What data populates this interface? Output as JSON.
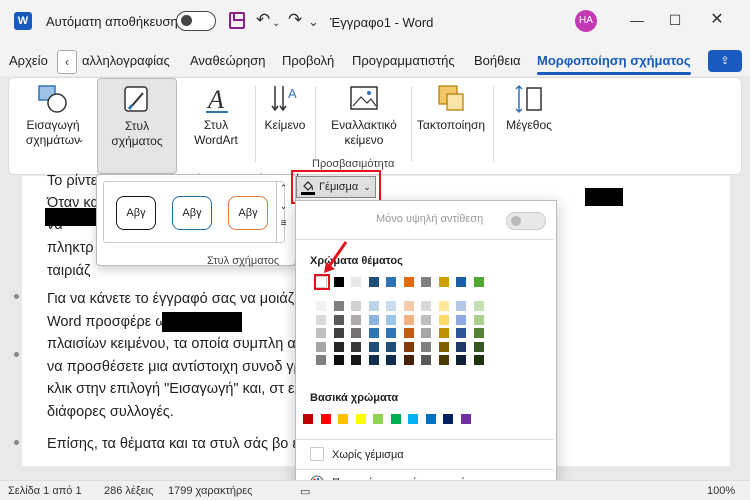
{
  "titlebar": {
    "app_logo": "W",
    "autosave_label": "Αυτόματη αποθήκευση",
    "document_title": "Έγγραφο1  -  Word",
    "avatar_initials": "HA",
    "icons": [
      "word-icon",
      "save-icon",
      "undo-icon",
      "redo-icon",
      "customize-icon"
    ]
  },
  "tabs": {
    "items": [
      "Αρχείο",
      "αλληλογραφίας",
      "Αναθεώρηση",
      "Προβολή",
      "Προγραμματιστής",
      "Βοήθεια"
    ],
    "active": "Μορφοποίηση σχήματος",
    "scroll_left": "‹"
  },
  "ribbon": {
    "groups": [
      {
        "label": "Εισαγωγή σχημάτων",
        "icon": "insert-shapes-icon"
      },
      {
        "label": "Στυλ σχήματος",
        "icon": "shape-styles-icon",
        "selected": true
      },
      {
        "label": "Στυλ WordArt",
        "icon": "wordart-icon"
      },
      {
        "label": "Κείμενο",
        "icon": "text-direction-icon"
      },
      {
        "label": "Εναλλακτικό κείμενο",
        "icon": "alt-text-icon"
      },
      {
        "label": "Τακτοποίηση",
        "icon": "arrange-icon"
      },
      {
        "label": "Μέγεθος",
        "icon": "size-icon"
      }
    ],
    "accessibility_caption": "Προσβασιμότητα"
  },
  "gallery": {
    "swatch_text": "Αβγ",
    "caption": "Στυλ σχήματος",
    "swatches": [
      {
        "border": "#1a1a1a"
      },
      {
        "border": "#1d6fa5"
      },
      {
        "border": "#e07b39"
      }
    ]
  },
  "fill_button": {
    "label": "Γέμισμα"
  },
  "dropdown": {
    "opacity_label": "Μόνο υψηλή αντίθεση",
    "theme_colors_heading": "Χρώματα θέματος",
    "standard_colors_heading": "Βασικά χρώματα",
    "no_fill_label": "Χωρίς γέμισμα",
    "more_colors_label": "Περισσότερα χρώματα γεμίσματος...",
    "theme_top_row": [
      "#ffffff",
      "#000000",
      "#e8e8e8",
      "#1f4e79",
      "#2f75b5",
      "#e46c0a",
      "#808080",
      "#c9a100",
      "#1a5fa8",
      "#4ea72e"
    ],
    "theme_shades": [
      [
        "#f2f2f2",
        "#7f7f7f",
        "#d0d0d0",
        "#bcd3ea",
        "#c9dcf0",
        "#f8cbad",
        "#d9d9d9",
        "#ffe699",
        "#b4c7e7",
        "#c5e0b4"
      ],
      [
        "#d9d9d9",
        "#595959",
        "#aeaaaa",
        "#8eb4de",
        "#9dc3e6",
        "#f4b183",
        "#bfbfbf",
        "#ffd966",
        "#8faadc",
        "#a9d18e"
      ],
      [
        "#bfbfbf",
        "#404040",
        "#757171",
        "#2e75b6",
        "#2f75b5",
        "#c55a11",
        "#a6a6a6",
        "#bf9000",
        "#2e5597",
        "#548235"
      ],
      [
        "#a6a6a6",
        "#262626",
        "#3a3838",
        "#1f4e79",
        "#1f4e79",
        "#843c0c",
        "#7f7f7f",
        "#7f6000",
        "#1f3864",
        "#385723"
      ],
      [
        "#7f7f7f",
        "#0d0d0d",
        "#171616",
        "#132e48",
        "#132e48",
        "#4a2106",
        "#595959",
        "#4a3800",
        "#121f38",
        "#203214"
      ]
    ],
    "standard_colors": [
      "#c00000",
      "#ff0000",
      "#ffc000",
      "#ffff00",
      "#92d050",
      "#00b050",
      "#00b0f0",
      "#0070c0",
      "#002060",
      "#7030a0"
    ]
  },
  "document": {
    "paragraphs": [
      "Το ρίντε                                                       σει να αποφασίσετε την άποψή σας.",
      "Όταν κα                                                      ίτε να επικολλήσετε τον",
      "                                                                    να",
      "πληκτρ                                                              που",
      "ταιριάζ",
      "Για να κάνετε το έγγραφό σας να μοιάζ                                  λματία, το",
      "Word προσφέρε                                                         ων και",
      "πλαισίων κειμένου, τα οποία συμπλη                                    α, μπορείτε",
      "να προσθέσετε μια αντίστοιχη συνοδ                                    γραμμή. Κάντε",
      "κλικ στην επιλογή \"Εισαγωγή\" και, στ                                  ελετε από τις",
      "διάφορες συλλογές.",
      "Επίσης, τα θέματα και τα στυλ σάς βο                                   έγγραφό"
    ]
  },
  "statusbar": {
    "page": "Σελίδα 1 από 1",
    "words": "286 λέξεις",
    "chars": "1799 χαρακτήρες",
    "zoom": "100%"
  }
}
